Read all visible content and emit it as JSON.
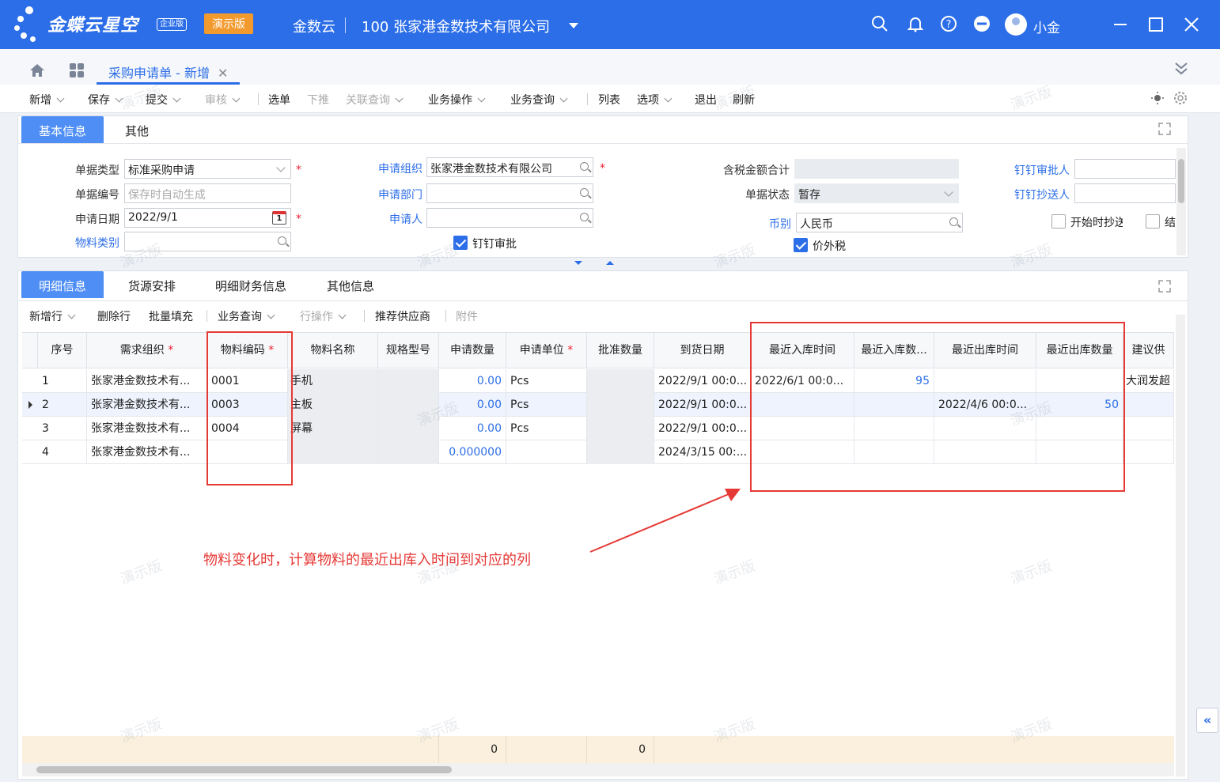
{
  "app": {
    "brand": "金蝶云星空",
    "edition": "企业版",
    "demo_tag": "演示版",
    "tenant": "金数云",
    "company": "100  张家港金数技术有限公司",
    "user": "小金"
  },
  "tabs": {
    "active": "采购申请单 - 新增"
  },
  "toolbar": {
    "new": "新增",
    "save": "保存",
    "submit": "提交",
    "audit": "审核",
    "select": "选单",
    "push": "下推",
    "linked_query": "关联查询",
    "biz_ops": "业务操作",
    "biz_query": "业务查询",
    "list": "列表",
    "options": "选项",
    "exit": "退出",
    "refresh": "刷新"
  },
  "header_panel": {
    "tabs": [
      "基本信息",
      "其他"
    ],
    "fields": {
      "doc_type_label": "单据类型",
      "doc_type_value": "标准采购申请",
      "doc_no_label": "单据编号",
      "doc_no_placeholder": "保存时自动生成",
      "apply_date_label": "申请日期",
      "apply_date_value": "2022/9/1",
      "material_cat_label": "物料类别",
      "apply_org_label": "申请组织",
      "apply_org_value": "张家港金数技术有限公司",
      "apply_dept_label": "申请部门",
      "applicant_label": "申请人",
      "dingding_approve": "钉钉审批",
      "tax_total_label": "含税金额合计",
      "doc_status_label": "单据状态",
      "doc_status_value": "暂存",
      "currency_label": "币别",
      "currency_value": "人民币",
      "price_excl_tax": "价外税",
      "dd_approver_label": "钉钉审批人",
      "dd_cc_label": "钉钉抄送人",
      "start_cc": "开始时抄送",
      "end_cc": "结"
    }
  },
  "detail_panel": {
    "tabs": [
      "明细信息",
      "货源安排",
      "明细财务信息",
      "其他信息"
    ],
    "toolbar": {
      "add_row": "新增行",
      "delete_row": "删除行",
      "batch_fill": "批量填充",
      "biz_query": "业务查询",
      "row_ops": "行操作",
      "recommend_supplier": "推荐供应商",
      "attachment": "附件"
    },
    "columns": [
      "序号",
      "需求组织",
      "物料编码",
      "物料名称",
      "规格型号",
      "申请数量",
      "申请单位",
      "批准数量",
      "到货日期",
      "最近入库时间",
      "最近入库数...",
      "最近出库时间",
      "最近出库数量",
      "建议供"
    ],
    "rows": [
      {
        "seq": "1",
        "org": "张家港金数技术有...",
        "code": "0001",
        "name": "手机",
        "spec": "",
        "qty": "0.00",
        "unit": "Pcs",
        "approved": "",
        "arrival": "2022/9/1 00:0...",
        "last_in_time": "2022/6/1 00:0...",
        "last_in_qty": "95",
        "last_out_time": "",
        "last_out_qty": "",
        "supplier": "大润发超"
      },
      {
        "seq": "2",
        "org": "张家港金数技术有...",
        "code": "0003",
        "name": "主板",
        "spec": "",
        "qty": "0.00",
        "unit": "Pcs",
        "approved": "",
        "arrival": "2022/9/1 00:0...",
        "last_in_time": "",
        "last_in_qty": "",
        "last_out_time": "2022/4/6 00:0...",
        "last_out_qty": "50",
        "supplier": ""
      },
      {
        "seq": "3",
        "org": "张家港金数技术有...",
        "code": "0004",
        "name": "屏幕",
        "spec": "",
        "qty": "0.00",
        "unit": "Pcs",
        "approved": "",
        "arrival": "2022/9/1 00:0...",
        "last_in_time": "",
        "last_in_qty": "",
        "last_out_time": "",
        "last_out_qty": "",
        "supplier": ""
      },
      {
        "seq": "4",
        "org": "张家港金数技术有...",
        "code": "",
        "name": "",
        "spec": "",
        "qty": "0.000000",
        "unit": "",
        "approved": "",
        "arrival": "2024/3/15 00:...",
        "last_in_time": "",
        "last_in_qty": "",
        "last_out_time": "",
        "last_out_qty": "",
        "supplier": ""
      }
    ],
    "totals": {
      "qty": "0",
      "approved": "0"
    }
  },
  "annotation": "物料变化时，计算物料的最近出库入时间到对应的列",
  "watermark": "演示版",
  "colors": {
    "primary": "#2c6ee8",
    "demo_tag": "#f29a2e",
    "annotation_red": "#e53935"
  }
}
